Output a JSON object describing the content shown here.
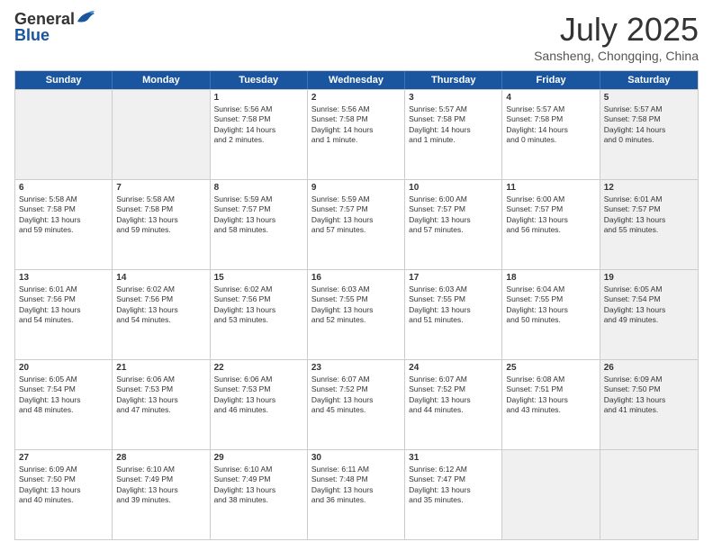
{
  "header": {
    "logo_general": "General",
    "logo_blue": "Blue",
    "month_title": "July 2025",
    "location": "Sansheng, Chongqing, China"
  },
  "weekdays": [
    "Sunday",
    "Monday",
    "Tuesday",
    "Wednesday",
    "Thursday",
    "Friday",
    "Saturday"
  ],
  "rows": [
    [
      {
        "day": "",
        "lines": [],
        "shaded": true
      },
      {
        "day": "",
        "lines": [],
        "shaded": true
      },
      {
        "day": "1",
        "lines": [
          "Sunrise: 5:56 AM",
          "Sunset: 7:58 PM",
          "Daylight: 14 hours",
          "and 2 minutes."
        ]
      },
      {
        "day": "2",
        "lines": [
          "Sunrise: 5:56 AM",
          "Sunset: 7:58 PM",
          "Daylight: 14 hours",
          "and 1 minute."
        ]
      },
      {
        "day": "3",
        "lines": [
          "Sunrise: 5:57 AM",
          "Sunset: 7:58 PM",
          "Daylight: 14 hours",
          "and 1 minute."
        ]
      },
      {
        "day": "4",
        "lines": [
          "Sunrise: 5:57 AM",
          "Sunset: 7:58 PM",
          "Daylight: 14 hours",
          "and 0 minutes."
        ]
      },
      {
        "day": "5",
        "lines": [
          "Sunrise: 5:57 AM",
          "Sunset: 7:58 PM",
          "Daylight: 14 hours",
          "and 0 minutes."
        ],
        "shaded": true
      }
    ],
    [
      {
        "day": "6",
        "lines": [
          "Sunrise: 5:58 AM",
          "Sunset: 7:58 PM",
          "Daylight: 13 hours",
          "and 59 minutes."
        ]
      },
      {
        "day": "7",
        "lines": [
          "Sunrise: 5:58 AM",
          "Sunset: 7:58 PM",
          "Daylight: 13 hours",
          "and 59 minutes."
        ]
      },
      {
        "day": "8",
        "lines": [
          "Sunrise: 5:59 AM",
          "Sunset: 7:57 PM",
          "Daylight: 13 hours",
          "and 58 minutes."
        ]
      },
      {
        "day": "9",
        "lines": [
          "Sunrise: 5:59 AM",
          "Sunset: 7:57 PM",
          "Daylight: 13 hours",
          "and 57 minutes."
        ]
      },
      {
        "day": "10",
        "lines": [
          "Sunrise: 6:00 AM",
          "Sunset: 7:57 PM",
          "Daylight: 13 hours",
          "and 57 minutes."
        ]
      },
      {
        "day": "11",
        "lines": [
          "Sunrise: 6:00 AM",
          "Sunset: 7:57 PM",
          "Daylight: 13 hours",
          "and 56 minutes."
        ]
      },
      {
        "day": "12",
        "lines": [
          "Sunrise: 6:01 AM",
          "Sunset: 7:57 PM",
          "Daylight: 13 hours",
          "and 55 minutes."
        ],
        "shaded": true
      }
    ],
    [
      {
        "day": "13",
        "lines": [
          "Sunrise: 6:01 AM",
          "Sunset: 7:56 PM",
          "Daylight: 13 hours",
          "and 54 minutes."
        ]
      },
      {
        "day": "14",
        "lines": [
          "Sunrise: 6:02 AM",
          "Sunset: 7:56 PM",
          "Daylight: 13 hours",
          "and 54 minutes."
        ]
      },
      {
        "day": "15",
        "lines": [
          "Sunrise: 6:02 AM",
          "Sunset: 7:56 PM",
          "Daylight: 13 hours",
          "and 53 minutes."
        ]
      },
      {
        "day": "16",
        "lines": [
          "Sunrise: 6:03 AM",
          "Sunset: 7:55 PM",
          "Daylight: 13 hours",
          "and 52 minutes."
        ]
      },
      {
        "day": "17",
        "lines": [
          "Sunrise: 6:03 AM",
          "Sunset: 7:55 PM",
          "Daylight: 13 hours",
          "and 51 minutes."
        ]
      },
      {
        "day": "18",
        "lines": [
          "Sunrise: 6:04 AM",
          "Sunset: 7:55 PM",
          "Daylight: 13 hours",
          "and 50 minutes."
        ]
      },
      {
        "day": "19",
        "lines": [
          "Sunrise: 6:05 AM",
          "Sunset: 7:54 PM",
          "Daylight: 13 hours",
          "and 49 minutes."
        ],
        "shaded": true
      }
    ],
    [
      {
        "day": "20",
        "lines": [
          "Sunrise: 6:05 AM",
          "Sunset: 7:54 PM",
          "Daylight: 13 hours",
          "and 48 minutes."
        ]
      },
      {
        "day": "21",
        "lines": [
          "Sunrise: 6:06 AM",
          "Sunset: 7:53 PM",
          "Daylight: 13 hours",
          "and 47 minutes."
        ]
      },
      {
        "day": "22",
        "lines": [
          "Sunrise: 6:06 AM",
          "Sunset: 7:53 PM",
          "Daylight: 13 hours",
          "and 46 minutes."
        ]
      },
      {
        "day": "23",
        "lines": [
          "Sunrise: 6:07 AM",
          "Sunset: 7:52 PM",
          "Daylight: 13 hours",
          "and 45 minutes."
        ]
      },
      {
        "day": "24",
        "lines": [
          "Sunrise: 6:07 AM",
          "Sunset: 7:52 PM",
          "Daylight: 13 hours",
          "and 44 minutes."
        ]
      },
      {
        "day": "25",
        "lines": [
          "Sunrise: 6:08 AM",
          "Sunset: 7:51 PM",
          "Daylight: 13 hours",
          "and 43 minutes."
        ]
      },
      {
        "day": "26",
        "lines": [
          "Sunrise: 6:09 AM",
          "Sunset: 7:50 PM",
          "Daylight: 13 hours",
          "and 41 minutes."
        ],
        "shaded": true
      }
    ],
    [
      {
        "day": "27",
        "lines": [
          "Sunrise: 6:09 AM",
          "Sunset: 7:50 PM",
          "Daylight: 13 hours",
          "and 40 minutes."
        ]
      },
      {
        "day": "28",
        "lines": [
          "Sunrise: 6:10 AM",
          "Sunset: 7:49 PM",
          "Daylight: 13 hours",
          "and 39 minutes."
        ]
      },
      {
        "day": "29",
        "lines": [
          "Sunrise: 6:10 AM",
          "Sunset: 7:49 PM",
          "Daylight: 13 hours",
          "and 38 minutes."
        ]
      },
      {
        "day": "30",
        "lines": [
          "Sunrise: 6:11 AM",
          "Sunset: 7:48 PM",
          "Daylight: 13 hours",
          "and 36 minutes."
        ]
      },
      {
        "day": "31",
        "lines": [
          "Sunrise: 6:12 AM",
          "Sunset: 7:47 PM",
          "Daylight: 13 hours",
          "and 35 minutes."
        ]
      },
      {
        "day": "",
        "lines": [],
        "shaded": true
      },
      {
        "day": "",
        "lines": [],
        "shaded": true
      }
    ]
  ]
}
